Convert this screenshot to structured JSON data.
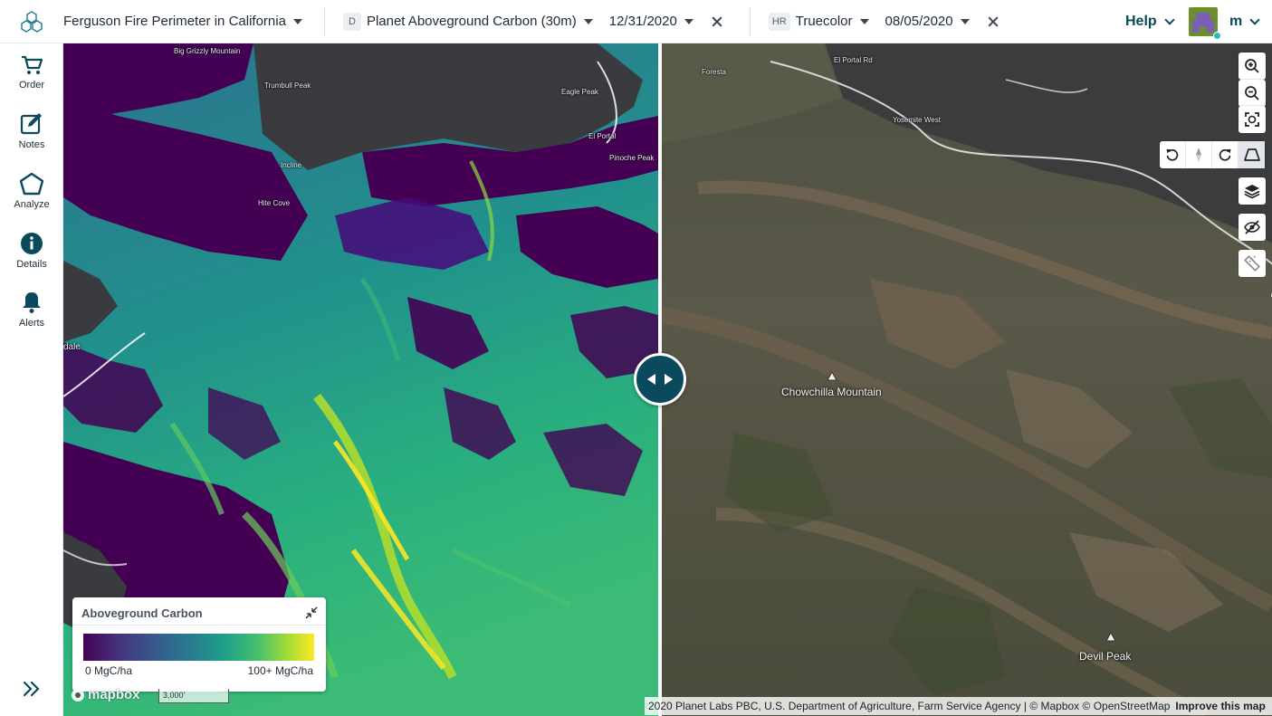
{
  "header": {
    "area": "Ferguson Fire Perimeter in California",
    "left_layer": {
      "badge": "D",
      "name": "Planet Aboveground Carbon (30m)",
      "date": "12/31/2020"
    },
    "right_layer": {
      "badge": "HR",
      "name": "Truecolor",
      "date": "08/05/2020"
    },
    "help_label": "Help",
    "user_initial": "m"
  },
  "sidebar": {
    "items": [
      {
        "label": "Order",
        "icon": "cart-icon"
      },
      {
        "label": "Notes",
        "icon": "notes-edit-icon"
      },
      {
        "label": "Analyze",
        "icon": "polygon-icon"
      },
      {
        "label": "Details",
        "icon": "info-icon"
      },
      {
        "label": "Alerts",
        "icon": "bell-icon"
      }
    ]
  },
  "map_left_labels": {
    "big_grizzly": "Big Grizzly Mountain",
    "trumbull_peak": "Trumbull Peak",
    "eagle_peak": "Eagle Peak",
    "el_portal": "El Portal",
    "pinoche_peak": "Pinoche Peak",
    "incline": "Incline",
    "hite_cove": "Hite Cove",
    "dale": "dale"
  },
  "map_right_labels": {
    "foresta": "Foresta",
    "el_portal_road": "El Portal Rd",
    "yosemite_west": "Yosemite West",
    "chowchilla": "Chowchilla Mountain",
    "devil_peak": "Devil Peak"
  },
  "legend": {
    "title": "Aboveground Carbon",
    "min_label": "0 MgC/ha",
    "max_label": "100+ MgC/ha"
  },
  "map_footer": {
    "mapbox_logo": "mapbox",
    "scale_label": "3,000'",
    "attribution": "2020 Planet Labs PBC, U.S. Department of Agriculture, Farm Service Agency | © Mapbox © OpenStreetMap",
    "improve_label": "Improve this map"
  },
  "colors": {
    "brand": "#0b4a5c",
    "carbon_low": "#440154",
    "carbon_high": "#fde725"
  }
}
